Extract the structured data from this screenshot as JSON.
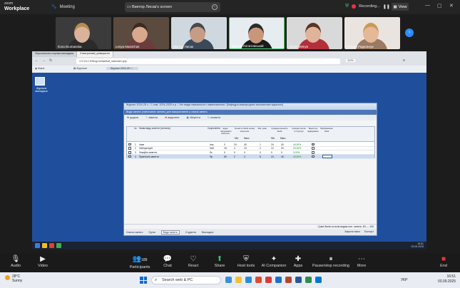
{
  "titlebar": {
    "logo_top": "zoom",
    "logo_bottom": "Workplace",
    "meeting_label": "Meeting",
    "screen_label": "Виктор Лисак's screen",
    "recording_label": "Recording...",
    "view_label": "View"
  },
  "participants": [
    {
      "name": "Ilona Diumanska",
      "bg": "#3b3b3b",
      "skin": "#d9b39a",
      "hair": "#b88a52",
      "shirt": "#2b2b2b"
    },
    {
      "name": "Lesya Matvichuk",
      "bg": "#5b4b3e",
      "skin": "#d8a98d",
      "hair": "#3a2a22",
      "shirt": "#6b3c3c"
    },
    {
      "name": "Виктор Лисак",
      "bg": "#cfd8df",
      "skin": "#c79c85",
      "hair": "#4a4a4a",
      "shirt": "#3b4a5a"
    },
    {
      "name": "Виктор Лопатовський",
      "bg": "#e6ecef",
      "skin": "#c8967a",
      "hair": "#2a2a2a",
      "shirt": "#1b1b1b"
    },
    {
      "name": "Alona Melnyk",
      "bg": "#d9d9d9",
      "skin": "#e0b39a",
      "hair": "#5a3520",
      "shirt": "#b32f3a"
    },
    {
      "name": "Галина Радельчук",
      "bg": "#e9e4df",
      "skin": "#e5b898",
      "hair": "#c89a55",
      "shirt": "#9a7a60"
    }
  ],
  "browser": {
    "tabs": [
      "Персональна сторінка викладача",
      "Електронний_університет"
    ],
    "url": "172.20.2.205/cgi-bin/kaf/kaf_inst/index.php",
    "zoom": "110%",
    "bookmarks": [
      "Маклі",
      "Журнали",
      "Журнал 2024-25 +..."
    ]
  },
  "desktop_icon_label": "Журнали викладача",
  "dialog": {
    "title": "Журнал 2024-25 з. / 1 сем. 2024-2025 н.р. / Усе видів навчального навантаження / [Кафедра міжнародних економічних відносин]",
    "subtitle": "Види занять (нав'язаних занять) для використання у спискі занять",
    "toolbar": [
      "додати",
      "змінити",
      "видалити",
      "зберегти",
      "оновити"
    ],
    "columns": [
      "№",
      "Назва виду заняття (поточна)",
      "Скорочення",
      "Індекс підсумкового контролю",
      "Кількість балів за вид контролю",
      "Мін.",
      "Макс.",
      "Мін. рекв.",
      "Сумарна кількість балів",
      "Мін.",
      "Макс.",
      "Середня частка в структурі",
      "Вимоги до відвідування",
      "Відображення балів"
    ],
    "rows": [
      {
        "n": "1",
        "name": "Інше",
        "abbr": "Інш",
        "a": "0",
        "b": "24",
        "c": "40",
        "d": "1",
        "e": "24",
        "f": "40",
        "pct": "40,00%",
        "chk": "x",
        "sel": false
      },
      {
        "n": "2",
        "name": "Лабораторні",
        "abbr": "Лаб",
        "a": "16",
        "b": "4",
        "c": "10",
        "d": "2",
        "e": "12",
        "f": "20",
        "pct": "20,00%",
        "chk": "",
        "sel": false
      },
      {
        "n": "3",
        "name": "Лекційні заняття",
        "abbr": "Лк",
        "a": "0",
        "b": "0",
        "c": "0",
        "d": "0",
        "e": "0",
        "f": "0",
        "pct": "0,00%",
        "chk": "",
        "sel": false
      },
      {
        "n": "4",
        "name": "Практичні заняття",
        "abbr": "Пр",
        "a": "60",
        "b": "2",
        "c": "3",
        "d": "8",
        "e": "24",
        "f": "40",
        "pct": "40,00%",
        "chk": "",
        "sel": true
      }
    ],
    "footer": "Сума балів по всім видам пон. занять: 60 — 100",
    "bottom_tabs": [
      "Список занять",
      "Групи",
      "Види занять",
      "Студенти",
      "Викладачі"
    ],
    "bottom_right": [
      "Закрити вікно",
      "Експорт"
    ]
  },
  "inner_tray": {
    "time": "16:51",
    "date": "03.09.2025"
  },
  "zoom_toolbar": {
    "audio": "Audio",
    "video": "Video",
    "participants": "Participants",
    "participants_count": "189",
    "chat": "Chat",
    "react": "React",
    "share": "Share",
    "host_tools": "Host tools",
    "ai": "AI Companion",
    "apps": "Apps",
    "pause": "Pause/stop recording",
    "more": "More",
    "end": "End"
  },
  "windows_taskbar": {
    "temp": "28°C",
    "weather": "Sunny",
    "search": "Search web & PC",
    "lang": "УКР",
    "time": "16:51",
    "date": "03.09.2025"
  }
}
